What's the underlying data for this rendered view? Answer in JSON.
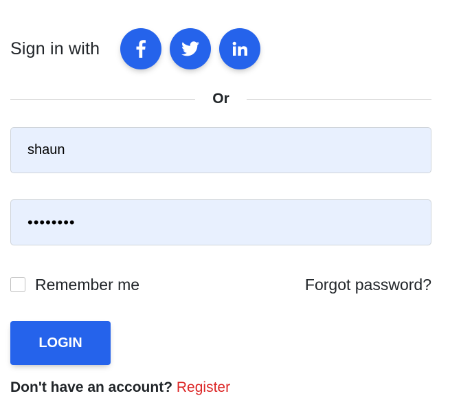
{
  "signin": {
    "label": "Sign in with",
    "providers": [
      {
        "name": "Facebook",
        "icon": "facebook-icon"
      },
      {
        "name": "Twitter",
        "icon": "twitter-icon"
      },
      {
        "name": "LinkedIn",
        "icon": "linkedin-icon"
      }
    ]
  },
  "divider": {
    "text": "Or"
  },
  "form": {
    "username_value": "shaun",
    "password_value": "********",
    "remember_label": "Remember me",
    "forgot_label": "Forgot password?",
    "login_label": "LOGIN"
  },
  "footer": {
    "prompt": "Don't have an account?",
    "register_label": "Register"
  },
  "colors": {
    "primary": "#2563eb",
    "link_red": "#dc2626",
    "field_bg": "#e8f0fe"
  }
}
